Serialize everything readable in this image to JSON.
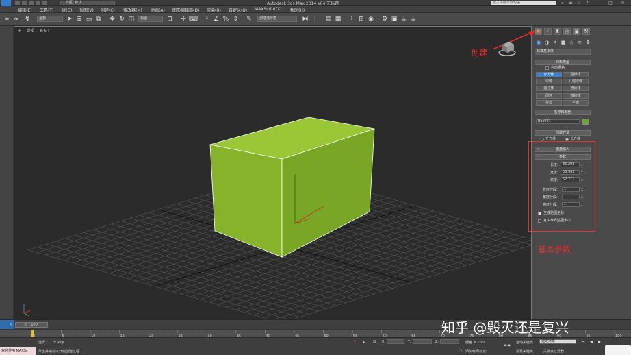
{
  "titlebar": {
    "title": "Autodesk 3ds Max  2014 x64      无标题",
    "workspace": "工作区: 默认",
    "search_placeholder": "键入关键字或短语"
  },
  "menu": [
    "编辑(E)",
    "工具(T)",
    "组(G)",
    "视图(V)",
    "创建(C)",
    "修改器(M)",
    "动画(A)",
    "图形编辑器(D)",
    "渲染(R)",
    "自定义(U)",
    "MAXScript(X)",
    "帮助(H)"
  ],
  "toolbar": {
    "filter": "全部",
    "refcoord": "视图",
    "selset": "创建选择集"
  },
  "viewport": {
    "label": "[ + ] [ 透视 ] [ 真实 ]",
    "box_color": "#86b32a"
  },
  "cmd_panel": {
    "category": "标准基本体",
    "object_type": {
      "header": "对象类型",
      "autogrid": "自动栅格",
      "buttons": [
        "长方体",
        "圆锥体",
        "球体",
        "几何球体",
        "圆柱体",
        "管状体",
        "圆环",
        "四棱锥",
        "茶壶",
        "平面"
      ]
    },
    "name_color": {
      "header": "名称和颜色",
      "name": "Box001",
      "color": "#6aaa2a"
    },
    "creation_method": {
      "header": "创建方法",
      "options": [
        "立方体",
        "长方体"
      ]
    },
    "keyboard_entry": "键盘输入",
    "params": {
      "header": "参数",
      "length_label": "长度:",
      "length": "86.206",
      "width_label": "宽度:",
      "width": "53.962",
      "height_label": "高度:",
      "height": "52.712",
      "lseg_label": "长度分段:",
      "lseg": "1",
      "wseg_label": "宽度分段:",
      "wseg": "1",
      "hseg_label": "高度分段:",
      "hseg": "1",
      "gen_uv": "生成贴图坐标",
      "real_world": "真实世界贴图大小"
    }
  },
  "annotations": {
    "create": "创建",
    "params": "基本参数",
    "color": "#e53030"
  },
  "timeline": {
    "frame": "0 / 100",
    "ticks": [
      "0",
      "5",
      "10",
      "15",
      "20",
      "25",
      "30",
      "35",
      "40",
      "45",
      "50",
      "55",
      "60",
      "65",
      "70",
      "75",
      "80",
      "85",
      "90",
      "95",
      "100"
    ]
  },
  "status": {
    "welcome": "欢迎使用 MAXSc",
    "selected": "选择了 1 个 对象",
    "hint": "单击并拖动以开始创建过程",
    "x_label": "X:",
    "y_label": "Y:",
    "z_label": "Z:",
    "grid": "栅格 = 10.0",
    "add_time_tag": "添加时间标记",
    "auto_key": "自动关键点",
    "selected_obj": "选定对象",
    "set_key": "设置关键点",
    "key_filters": "关键点过滤器..."
  },
  "watermark": "知乎 @毁灭还是复兴"
}
